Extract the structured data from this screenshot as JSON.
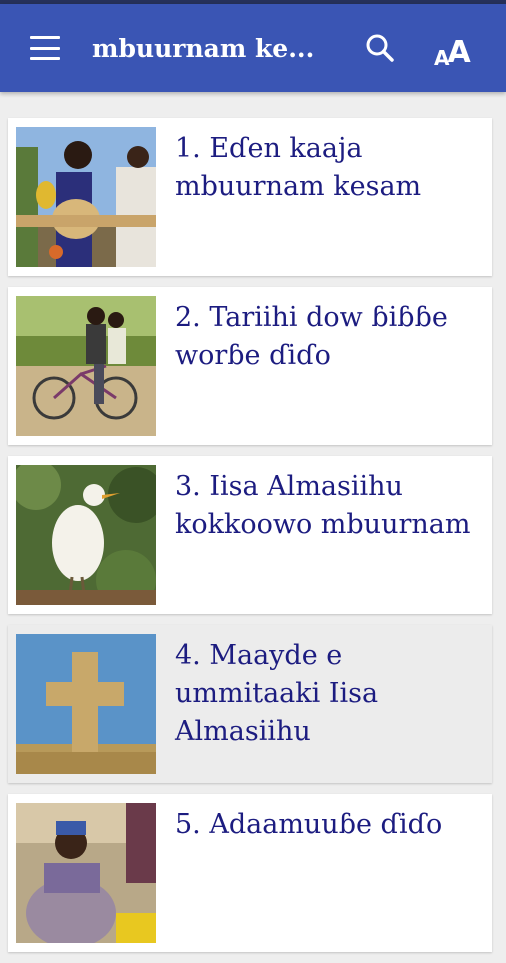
{
  "app_bar": {
    "title": "mbuurnam ke...",
    "menu_icon": "menu-icon",
    "search_icon": "search-icon",
    "font_icon": "font-size-icon",
    "font_small": "A",
    "font_big": "A"
  },
  "chapters": [
    {
      "title": "1. Eɗen kaaja mbuurnam kesam",
      "image": "people-with-gourds"
    },
    {
      "title": "2. Tariihi dow ɓiɓɓe worɓe ɗiɗo",
      "image": "two-boys-on-bicycle"
    },
    {
      "title": "3. Iisa Almasiihu kokkoowo mbuurnam",
      "image": "white-egret-bird"
    },
    {
      "title": "4. Maayde e ummitaaki Iisa Almasiihu",
      "image": "stone-cross"
    },
    {
      "title": "5. Adaamuuɓe ɗiɗo",
      "image": "seated-man-turban"
    }
  ],
  "colors": {
    "app_bar": "#3a55b4",
    "title_text": "#1c1c80",
    "background": "#eeeeee",
    "selected_card": "#ececec"
  }
}
